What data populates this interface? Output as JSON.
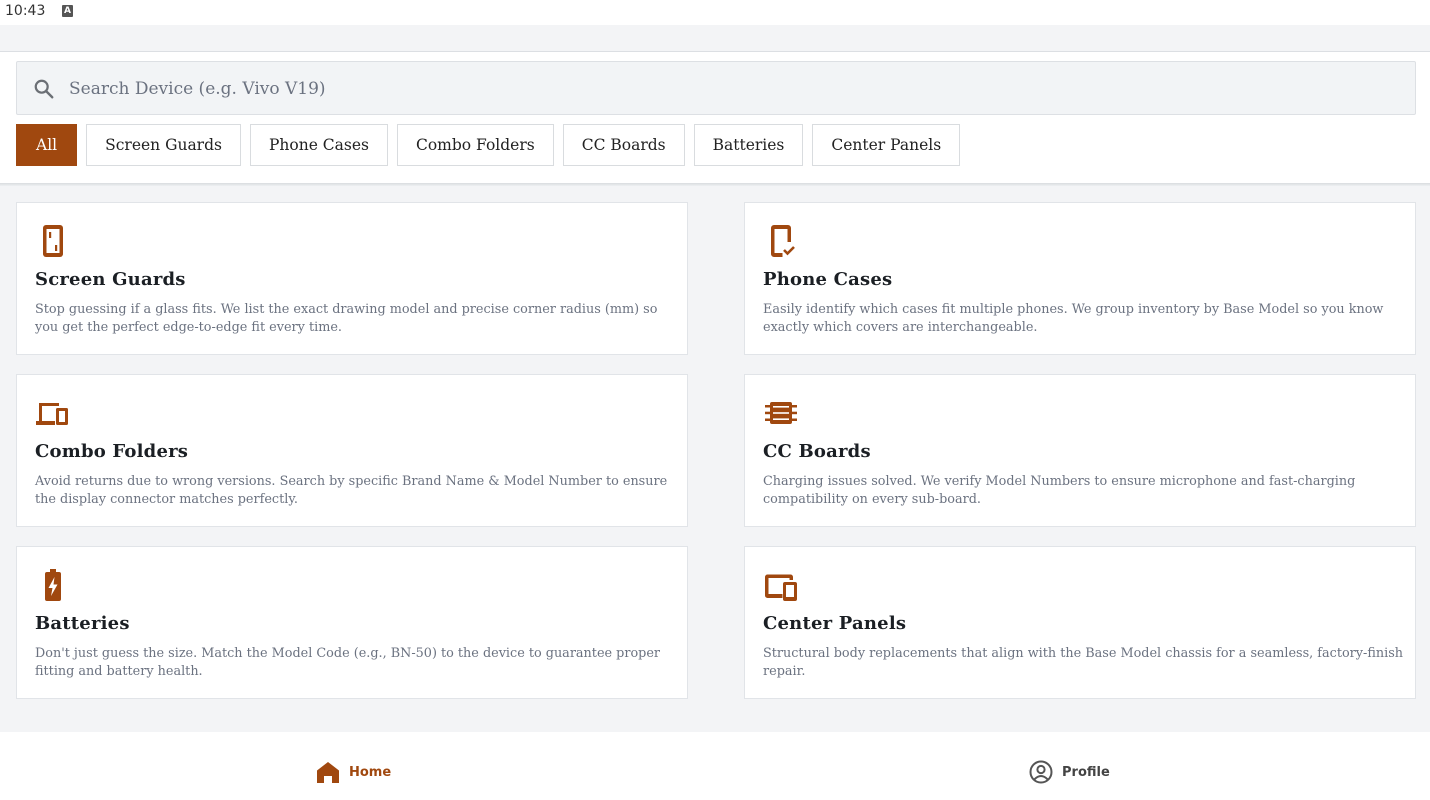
{
  "status_bar": {
    "time": "10:43",
    "indicator": "A"
  },
  "search": {
    "placeholder": "Search Device (e.g. Vivo V19)",
    "value": ""
  },
  "filters": [
    {
      "label": "All",
      "active": true
    },
    {
      "label": "Screen Guards",
      "active": false
    },
    {
      "label": "Phone Cases",
      "active": false
    },
    {
      "label": "Combo Folders",
      "active": false
    },
    {
      "label": "CC Boards",
      "active": false
    },
    {
      "label": "Batteries",
      "active": false
    },
    {
      "label": "Center Panels",
      "active": false
    }
  ],
  "cards": [
    {
      "icon": "phone-outline-icon",
      "title": "Screen Guards",
      "description": "Stop guessing if a glass fits. We list the exact drawing model and precise corner radius (mm) so you get the perfect edge-to-edge fit every time."
    },
    {
      "icon": "phone-check-icon",
      "title": "Phone Cases",
      "description": "Easily identify which cases fit multiple phones. We group inventory by Base Model so you know exactly which covers are interchangeable."
    },
    {
      "icon": "devices-icon",
      "title": "Combo Folders",
      "description": "Avoid returns due to wrong versions. Search by specific Brand Name & Model Number to ensure the display connector matches perfectly."
    },
    {
      "icon": "chip-board-icon",
      "title": "CC Boards",
      "description": "Charging issues solved. We verify Model Numbers to ensure microphone and fast-charging compatibility on every sub-board."
    },
    {
      "icon": "battery-charging-icon",
      "title": "Batteries",
      "description": "Don't just guess the size. Match the Model Code (e.g., BN-50) to the device to guarantee proper fitting and battery health."
    },
    {
      "icon": "tablet-phone-icon",
      "title": "Center Panels",
      "description": "Structural body replacements that align with the Base Model chassis for a seamless, factory-finish repair."
    }
  ],
  "bottom_nav": [
    {
      "label": "Home",
      "icon": "home-icon",
      "active": true
    },
    {
      "label": "Profile",
      "icon": "profile-icon",
      "active": false
    }
  ],
  "colors": {
    "accent": "#a0480f",
    "background": "#f3f4f6",
    "card": "#ffffff",
    "text_muted": "#6b7280"
  }
}
